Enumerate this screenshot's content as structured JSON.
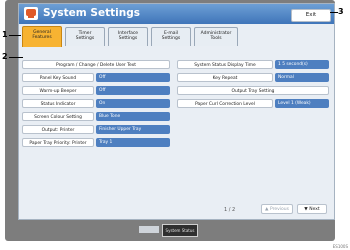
{
  "window": {
    "title": "System Settings",
    "exit_label": "Exit"
  },
  "tabs": [
    {
      "line1": "General",
      "line2": "Features",
      "active": true
    },
    {
      "line1": "Timer",
      "line2": "Settings",
      "active": false
    },
    {
      "line1": "Interface",
      "line2": "Settings",
      "active": false
    },
    {
      "line1": "E-mail",
      "line2": "Settings",
      "active": false
    },
    {
      "line1": "Administrator",
      "line2": "Tools",
      "active": false
    }
  ],
  "left_settings": [
    {
      "label": "Program / Change / Delete User Text",
      "value": ""
    },
    {
      "label": "Panel Key Sound",
      "value": "Off"
    },
    {
      "label": "Warm-up Beeper",
      "value": "Off"
    },
    {
      "label": "Status Indicator",
      "value": "On"
    },
    {
      "label": "Screen Colour Setting",
      "value": "Blue Tone"
    },
    {
      "label": "Output: Printer",
      "value": "Finisher Upper Tray"
    },
    {
      "label": "Paper Tray Priority: Printer",
      "value": "Tray 1"
    }
  ],
  "right_settings": [
    {
      "label": "System Status Display Time",
      "value": "1 5 second(s)"
    },
    {
      "label": "Key Repeat",
      "value": "Normal"
    },
    {
      "label": "Output Tray Setting",
      "value": ""
    },
    {
      "label": "Paper Curl Correction Level",
      "value": "Level 1 (Weak)"
    }
  ],
  "pagination": {
    "page_text": "1 / 2",
    "prev_label": "Previous",
    "next_label": "Next"
  },
  "footer": {
    "status_label": "System Status"
  },
  "callouts": {
    "c1": "1",
    "c2": "2",
    "c3": "3"
  },
  "image_id": "ES100S"
}
